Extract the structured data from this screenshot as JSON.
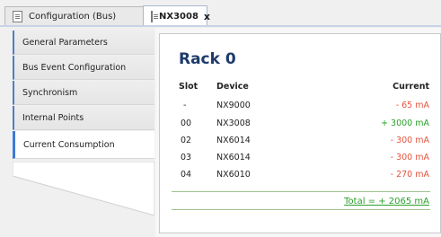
{
  "tabs": [
    {
      "label": "Configuration (Bus)",
      "icon": "document-icon",
      "active": false
    },
    {
      "label": "NX3008",
      "icon": "document-icon",
      "active": true,
      "close": "x"
    }
  ],
  "sidebar": {
    "items": [
      {
        "label": "General Parameters"
      },
      {
        "label": "Bus Event Configuration"
      },
      {
        "label": "Synchronism"
      },
      {
        "label": "Internal Points"
      },
      {
        "label": "Current Consumption",
        "active": true
      }
    ]
  },
  "main": {
    "title": "Rack 0",
    "columns": {
      "slot": "Slot",
      "device": "Device",
      "current": "Current"
    },
    "rows": [
      {
        "slot": "-",
        "device": "NX9000",
        "current": "- 65 mA",
        "sign": "neg"
      },
      {
        "slot": "00",
        "device": "NX3008",
        "current": "+ 3000 mA",
        "sign": "pos"
      },
      {
        "slot": "02",
        "device": "NX6014",
        "current": "- 300 mA",
        "sign": "neg"
      },
      {
        "slot": "03",
        "device": "NX6014",
        "current": "- 300 mA",
        "sign": "neg"
      },
      {
        "slot": "04",
        "device": "NX6010",
        "current": "- 270 mA",
        "sign": "neg"
      }
    ],
    "total": "Total = + 2065 mA"
  },
  "colors": {
    "negative": "#e4543d",
    "positive": "#2aa02a",
    "title": "#1d3b6b",
    "accent": "#3d7bd6"
  }
}
